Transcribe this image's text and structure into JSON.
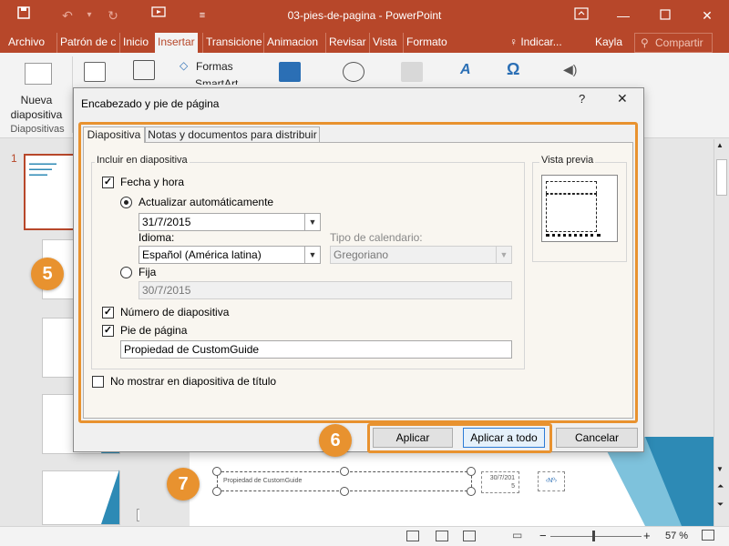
{
  "window": {
    "title": "03-pies-de-pagina - PowerPoint"
  },
  "ribbon_tabs": [
    "Archivo",
    "Patrón de c",
    "Inicio",
    "Insertar",
    "Transicione",
    "Animacion",
    "Revisar",
    "Vista",
    "Formato"
  ],
  "ribbon_right": {
    "tell_me": "Indicar...",
    "user": "Kayla",
    "share": "Compartir"
  },
  "ribbon": {
    "new_slide_line1": "Nueva",
    "new_slide_line2": "diapositiva",
    "slides_group": "Diapositivas",
    "shapes": "Formas",
    "smartart": "SmartArt"
  },
  "slide_number": "1",
  "dialog": {
    "title": "Encabezado y pie de página",
    "help": "?",
    "close": "✕",
    "tabs": [
      "Diapositiva",
      "Notas y documentos para distribuir"
    ],
    "include_group": "Incluir en diapositiva",
    "date_time": "Fecha y hora",
    "auto_update": "Actualizar automáticamente",
    "auto_date_value": "31/7/2015",
    "language_label": "Idioma:",
    "language_value": "Español (América latina)",
    "calendar_label": "Tipo de calendario:",
    "calendar_value": "Gregoriano",
    "fixed": "Fija",
    "fixed_value": "30/7/2015",
    "slide_number": "Número de diapositiva",
    "footer": "Pie de página",
    "footer_value": "Propiedad de CustomGuide",
    "dont_show_title": "No mostrar en diapositiva de título",
    "preview_label": "Vista previa",
    "apply": "Aplicar",
    "apply_all": "Aplicar a todo",
    "cancel": "Cancelar"
  },
  "callouts": [
    "5",
    "6",
    "7"
  ],
  "slide_footer": {
    "footer_text": "Propiedad de CustomGuide",
    "date_text_line1": "30/7/201",
    "date_text_line2": "5",
    "number_text": "‹Nº›"
  },
  "status": {
    "zoom": "57 %"
  },
  "colors": {
    "accent": "#b7472a",
    "highlight": "#e8922f"
  }
}
